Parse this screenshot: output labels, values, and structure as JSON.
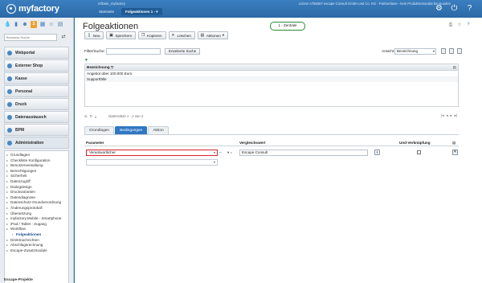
{
  "header": {
    "logo_text": "myfactory",
    "db_label": "mfDate_myfactory",
    "company": "Lizenz A758367 escape Consult GmbH und Co. KG - Partnerbase - kein Produktivmandat bei Kunden",
    "tabs": [
      {
        "label": "Startseite"
      },
      {
        "label": "Folgeaktionen 1 - ▾"
      }
    ],
    "icons": [
      "gear-icon",
      "power-icon",
      "help-icon"
    ]
  },
  "sidebar": {
    "search_placeholder": "Business-Suche",
    "modules": [
      {
        "label": "Webportal"
      },
      {
        "label": "Externer Shop"
      },
      {
        "label": "Kasse"
      },
      {
        "label": "Personal"
      },
      {
        "label": "Druck"
      },
      {
        "label": "Datenaustausch"
      },
      {
        "label": "BPM"
      },
      {
        "label": "Administration"
      }
    ],
    "tree": [
      {
        "label": "Grundlagen"
      },
      {
        "label": "Checkliste Konfiguration"
      },
      {
        "label": "Benutzerverwaltung"
      },
      {
        "label": "Berechtigungen"
      },
      {
        "label": "Sicherheit"
      },
      {
        "label": "Datenzugriff"
      },
      {
        "label": "Dialogdesign"
      },
      {
        "label": "Druckvarianten"
      },
      {
        "label": "Datendiagnose"
      },
      {
        "label": "Datenschutz-Grundverordnung"
      },
      {
        "label": "Änderungsprotokoll"
      },
      {
        "label": "Übersetzung"
      },
      {
        "label": "myfactory.Mobile - Smartphone"
      },
      {
        "label": "iPad / Tablet - Zugang"
      },
      {
        "label": "Workflow"
      },
      {
        "label": "Folgeaktionen"
      },
      {
        "label": "Direktnachrichten"
      },
      {
        "label": "Abschlagsrechnung"
      },
      {
        "label": "Escape-Zusatzmodule"
      }
    ],
    "bottom_module": "Escape-Projekte"
  },
  "main": {
    "title": "Folgeaktionen",
    "branch_badge": "1 - Zentrale",
    "toolbar": {
      "new": "Neu",
      "save": "Speichern",
      "copy": "Kopieren",
      "delete": "Löschen",
      "actions": "Aktionen"
    },
    "filter": {
      "label": "Filter/Suche:",
      "value": "",
      "extended_search": "Erweiterte Suche",
      "view_label": "Ansicht:",
      "view_value": "Bezeichnung"
    },
    "list": {
      "column_header": "Bezeichnung",
      "rows": [
        {
          "label": "Angebot über 100.000 Euro"
        },
        {
          "label": "Supportfälle"
        }
      ]
    },
    "pager": {
      "text": "Datensätze 1 - 2 von 2"
    },
    "subtabs": [
      {
        "label": "Grundlagen"
      },
      {
        "label": "Bedingungen"
      },
      {
        "label": "Aktion"
      }
    ],
    "conditions": {
      "col_parameter": "Parameter",
      "col_compare": "Vergleichswert",
      "col_and": "Und-Verknüpfung",
      "rows": [
        {
          "parameter": "Verantwortlicher",
          "operator": "=",
          "value": "Escape Consult",
          "and": false
        }
      ]
    }
  }
}
